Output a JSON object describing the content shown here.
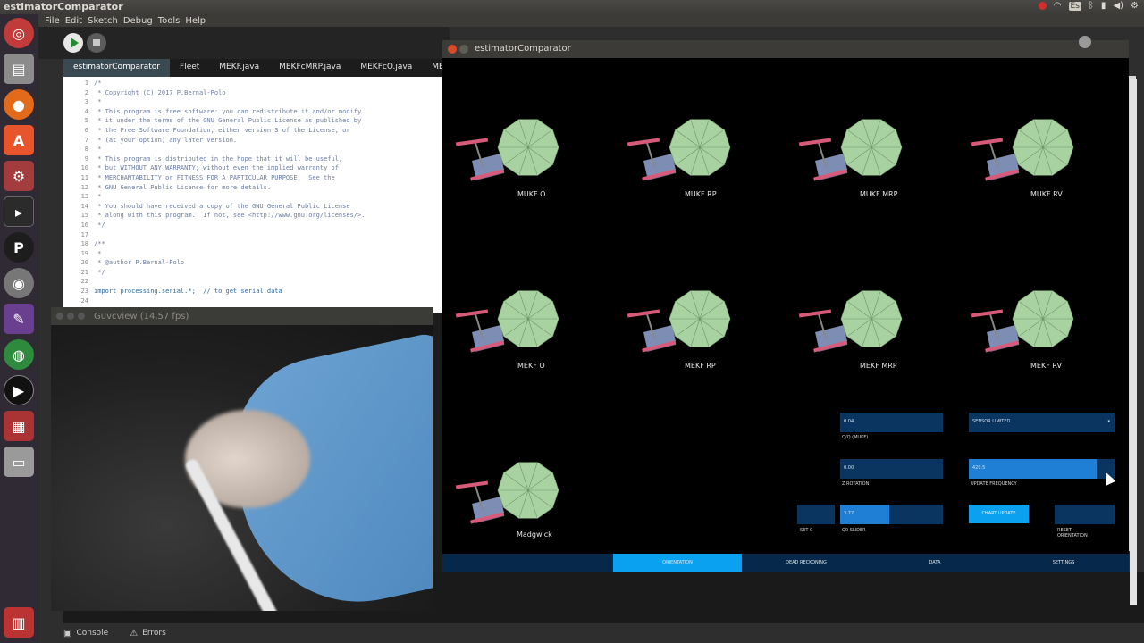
{
  "top_panel": {
    "title": "estimatorComparator"
  },
  "ide": {
    "menu": [
      "File",
      "Edit",
      "Sketch",
      "Debug",
      "Tools",
      "Help"
    ],
    "tabs": [
      {
        "label": "estimatorComparator",
        "active": true
      },
      {
        "label": "Fleet"
      },
      {
        "label": "MEKF.java"
      },
      {
        "label": "MEKFcMRP.java"
      },
      {
        "label": "MEKFcO.java"
      },
      {
        "label": "MEKFc"
      }
    ],
    "line_numbers": [
      "1",
      "2",
      "3",
      "4",
      "5",
      "6",
      "7",
      "8",
      "9",
      "10",
      "11",
      "12",
      "13",
      "14",
      "15",
      "16",
      "17",
      "18",
      "19",
      "20",
      "21",
      "22",
      "23",
      "24"
    ],
    "code_lines": [
      "/*",
      " * Copyright (C) 2017 P.Bernal-Polo",
      " *",
      " * This program is free software: you can redistribute it and/or modify",
      " * it under the terms of the GNU General Public License as published by",
      " * the Free Software Foundation, either version 3 of the License, or",
      " * (at your option) any later version.",
      " *",
      " * This program is distributed in the hope that it will be useful,",
      " * but WITHOUT ANY WARRANTY; without even the implied warranty of",
      " * MERCHANTABILITY or FITNESS FOR A PARTICULAR PURPOSE.  See the",
      " * GNU General Public License for more details.",
      " *",
      " * You should have received a copy of the GNU General Public License",
      " * along with this program.  If not, see <http://www.gnu.org/licenses/>.",
      " */",
      "",
      "/**",
      " *",
      " * @author P.Bernal-Polo",
      " */",
      "",
      "import processing.serial.*;  // to get serial data",
      ""
    ],
    "console_tabs": [
      {
        "label": "Console",
        "icon": "console-icon"
      },
      {
        "label": "Errors",
        "icon": "warning-icon"
      }
    ]
  },
  "guvcview": {
    "title": "Guvcview  (14,57 fps)"
  },
  "estimator": {
    "title": "estimatorComparator",
    "models": [
      {
        "label": "MUKF O"
      },
      {
        "label": "MUKF RP"
      },
      {
        "label": "MUKF MRP"
      },
      {
        "label": "MUKF RV"
      },
      {
        "label": "MEKF O"
      },
      {
        "label": "MEKF RP"
      },
      {
        "label": "MEKF MRP"
      },
      {
        "label": "MEKF RV"
      },
      {
        "label": "Madgwick"
      }
    ],
    "controls": {
      "q0_value": "0.04",
      "q0_label": "Q/Q (MUKF)",
      "sensor_value": "SENSOR LIMITED",
      "sensor_arrow": "▾",
      "z_rotation_value": "0.00",
      "z_rotation_label": "Z ROTATION",
      "update_freq_value": "420.5",
      "update_freq_label": "UPDATE FREQUENCY",
      "update_freq_level": 0.88,
      "set0_label": "SET 0",
      "q0_slider_value": "3.77",
      "q0_slider_label": "Q0 SLIDER",
      "q0_slider_level": 0.48,
      "chart_update_label": "CHART UPDATE",
      "reset_label_1": "RESET",
      "reset_label_2": "ORIENTATION"
    },
    "nav": [
      {
        "label": "ORIENTATION",
        "active": true
      },
      {
        "label": "DEAD RECKONING"
      },
      {
        "label": "DATA"
      },
      {
        "label": "SETTINGS"
      }
    ]
  },
  "colors": {
    "disc": "#a8d3a0",
    "bar_red": "#d85a78",
    "board": "#7d8db3",
    "accent": "#0aa1f0",
    "panel_blue": "#0a3560"
  }
}
